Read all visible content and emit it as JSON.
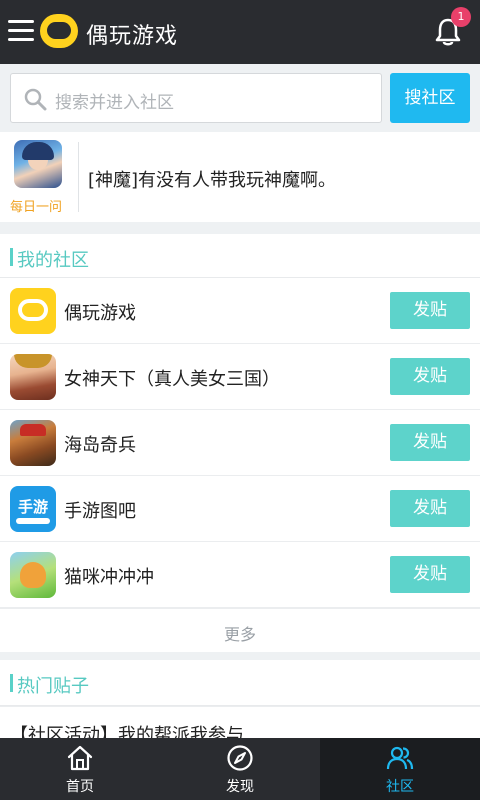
{
  "header": {
    "app_title": "偶玩游戏",
    "notification_count": "1"
  },
  "search": {
    "placeholder": "搜索并进入社区",
    "button_label": "搜社区"
  },
  "daily": {
    "label": "每日一问",
    "question": "[神魔]有没有人带我玩神魔啊。"
  },
  "my_community": {
    "title": "我的社区",
    "items": [
      {
        "name": "偶玩游戏",
        "icon": "ouwan-logo-icon",
        "action": "发贴"
      },
      {
        "name": "女神天下（真人美女三国）",
        "icon": "goddess-game-icon",
        "action": "发贴"
      },
      {
        "name": "海岛奇兵",
        "icon": "boom-beach-icon",
        "action": "发贴"
      },
      {
        "name": "手游图吧",
        "icon": "shouyou-tuba-icon",
        "action": "发贴",
        "icon_text": "手游"
      },
      {
        "name": "猫咪冲冲冲",
        "icon": "cat-game-icon",
        "action": "发贴"
      }
    ],
    "more_label": "更多"
  },
  "hot_posts": {
    "title": "热门贴子",
    "items": [
      {
        "title": "【社区活动】我的帮派我参与"
      }
    ]
  },
  "bottom_nav": {
    "items": [
      {
        "label": "首页",
        "icon": "home-icon"
      },
      {
        "label": "发现",
        "icon": "compass-icon"
      },
      {
        "label": "社区",
        "icon": "community-icon",
        "active": true
      }
    ]
  },
  "colors": {
    "topbar": "#2a2c30",
    "accent_blue": "#1fb9f0",
    "accent_teal": "#5dd3cb",
    "logo_yellow": "#ffd21e",
    "badge_red": "#e8406a"
  }
}
